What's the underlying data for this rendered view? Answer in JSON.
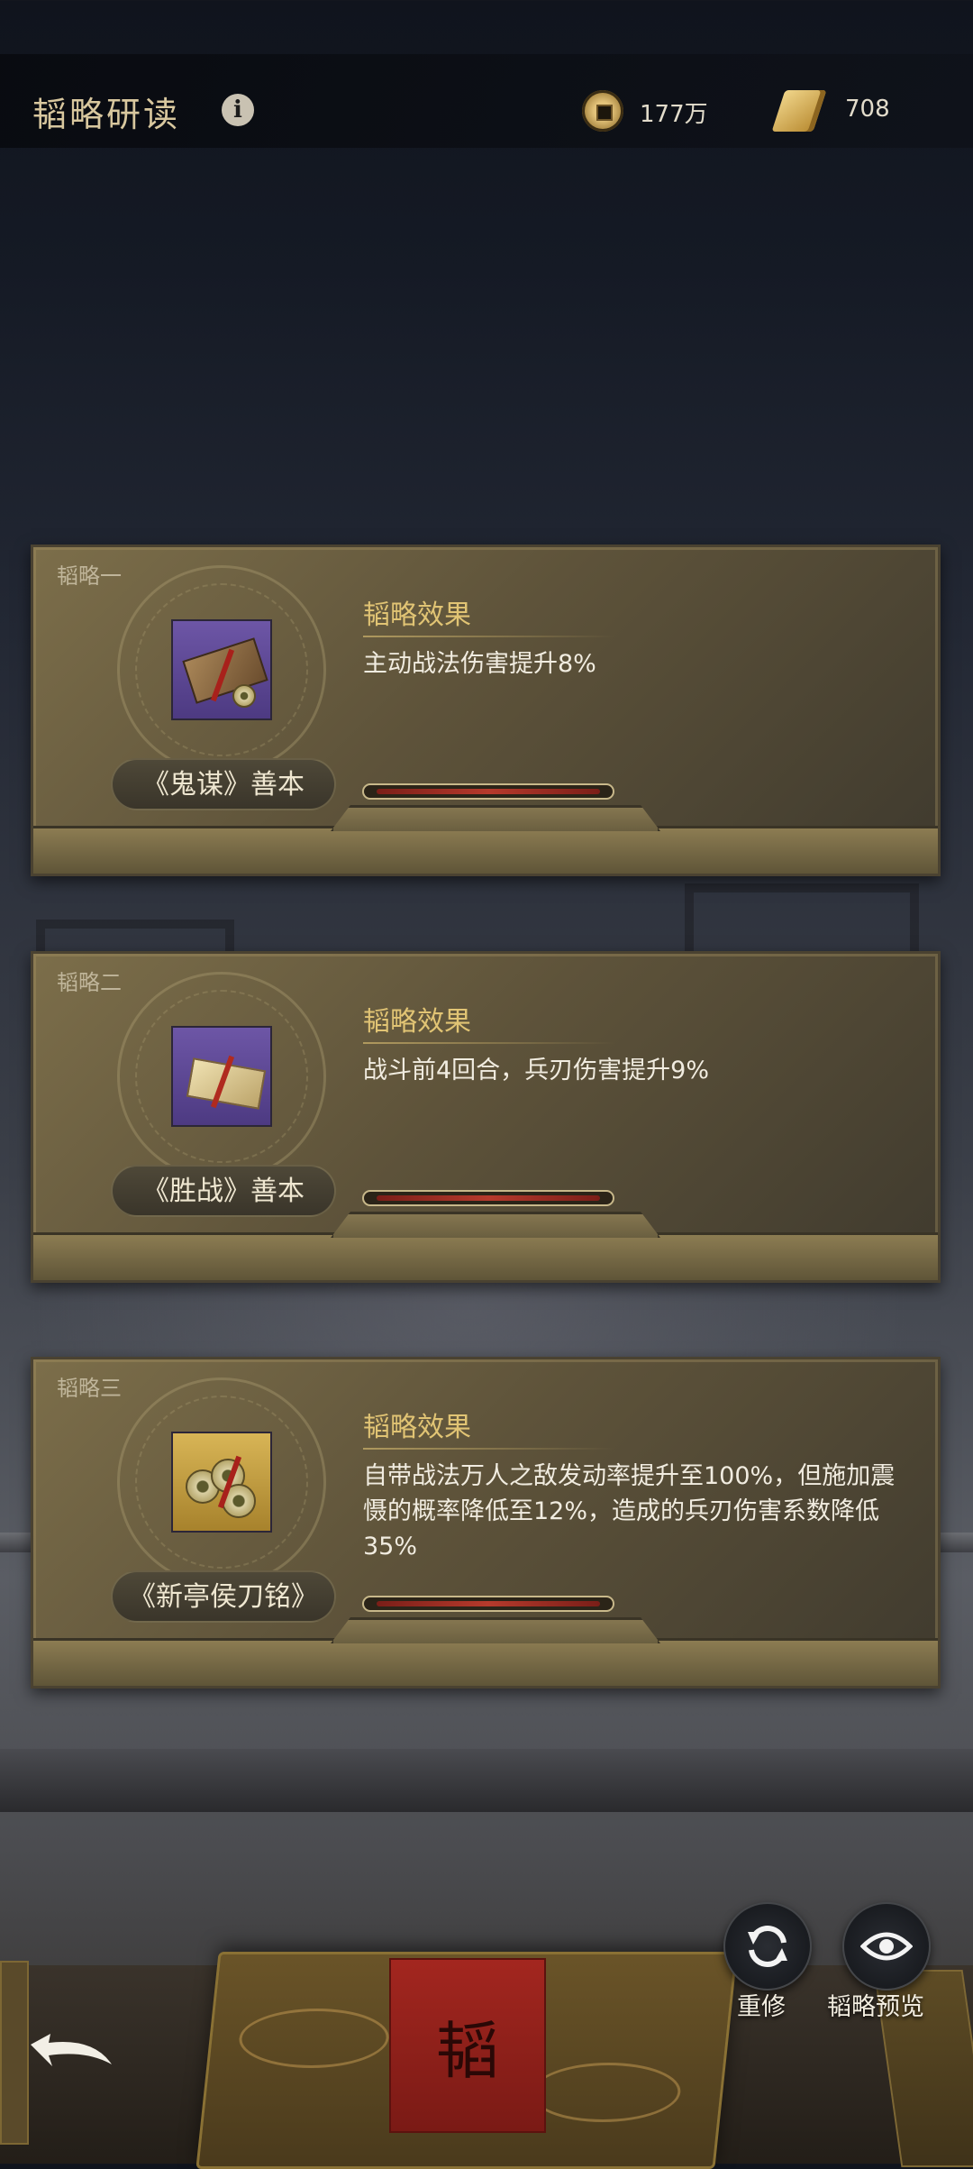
{
  "header": {
    "title": "韬略研读",
    "coins": "177万",
    "scrolls": "708"
  },
  "cards": [
    {
      "label": "韬略一",
      "book_name": "《鬼谋》善本",
      "effect_title": "韬略效果",
      "effect_text": "主动战法伤害提升8%"
    },
    {
      "label": "韬略二",
      "book_name": "《胜战》善本",
      "effect_title": "韬略效果",
      "effect_text": "战斗前4回合，兵刃伤害提升9%"
    },
    {
      "label": "韬略三",
      "book_name": "《新亭侯刀铭》",
      "effect_title": "韬略效果",
      "effect_text": "自带战法万人之敌发动率提升至100%，但施加震慑的概率降低至12%，造成的兵刃伤害系数降低35%"
    }
  ],
  "controls": {
    "reforge_label": "重修",
    "preview_label": "韬略预览"
  },
  "icons": {
    "info": "info-icon",
    "coin": "copper-coin-icon",
    "scroll": "scroll-icon",
    "reforge": "refresh-icon",
    "preview": "eye-icon",
    "back": "back-arrow-icon"
  }
}
